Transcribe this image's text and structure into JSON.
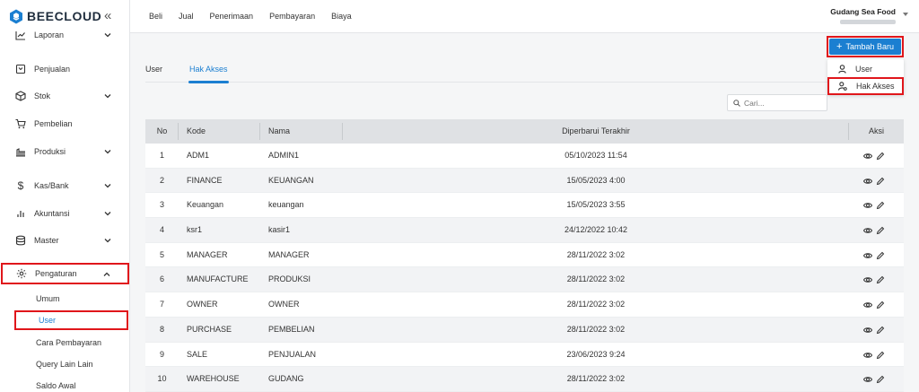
{
  "brand": {
    "name": "BEECLOUD",
    "color": "#1b7fd1"
  },
  "sidebar": {
    "items": [
      {
        "label": "Laporan",
        "icon": "trend-icon",
        "has_children": true
      },
      {
        "label": "Penjualan",
        "icon": "receipt-icon",
        "has_children": false
      },
      {
        "label": "Stok",
        "icon": "box-icon",
        "has_children": true
      },
      {
        "label": "Pembelian",
        "icon": "cart-icon",
        "has_children": false
      },
      {
        "label": "Produksi",
        "icon": "factory-icon",
        "has_children": true
      },
      {
        "label": "Kas/Bank",
        "icon": "dollar-icon",
        "has_children": true
      },
      {
        "label": "Akuntansi",
        "icon": "bar-chart-icon",
        "has_children": true
      },
      {
        "label": "Master",
        "icon": "database-icon",
        "has_children": true
      },
      {
        "label": "Pengaturan",
        "icon": "gear-icon",
        "has_children": true,
        "expanded": true
      }
    ],
    "subitems": [
      {
        "label": "Umum",
        "active": false
      },
      {
        "label": "User",
        "active": true
      },
      {
        "label": "Cara Pembayaran",
        "active": false
      },
      {
        "label": "Query Lain Lain",
        "active": false
      },
      {
        "label": "Saldo Awal",
        "active": false
      }
    ]
  },
  "topnav": [
    "Beli",
    "Jual",
    "Penerimaan",
    "Pembayaran",
    "Biaya"
  ],
  "company": {
    "name": "Gudang Sea Food"
  },
  "tabs": [
    {
      "label": "User",
      "active": false
    },
    {
      "label": "Hak Akses",
      "active": true
    }
  ],
  "add_button": {
    "label": "Tambah Baru"
  },
  "dropdown": [
    {
      "label": "User",
      "icon": "user-icon"
    },
    {
      "label": "Hak Akses",
      "icon": "user-key-icon"
    }
  ],
  "search": {
    "placeholder": "Cari..."
  },
  "table": {
    "columns": [
      "No",
      "Kode",
      "Nama",
      "Diperbarui Terakhir",
      "Aksi"
    ],
    "rows": [
      {
        "no": "1",
        "kode": "ADM1",
        "nama": "ADMIN1",
        "updated": "05/10/2023 11:54"
      },
      {
        "no": "2",
        "kode": "FINANCE",
        "nama": "KEUANGAN",
        "updated": "15/05/2023 4:00"
      },
      {
        "no": "3",
        "kode": "Keuangan",
        "nama": "keuangan",
        "updated": "15/05/2023 3:55"
      },
      {
        "no": "4",
        "kode": "ksr1",
        "nama": "kasir1",
        "updated": "24/12/2022 10:42"
      },
      {
        "no": "5",
        "kode": "MANAGER",
        "nama": "MANAGER",
        "updated": "28/11/2022 3:02"
      },
      {
        "no": "6",
        "kode": "MANUFACTURE",
        "nama": "PRODUKSI",
        "updated": "28/11/2022 3:02"
      },
      {
        "no": "7",
        "kode": "OWNER",
        "nama": "OWNER",
        "updated": "28/11/2022 3:02"
      },
      {
        "no": "8",
        "kode": "PURCHASE",
        "nama": "PEMBELIAN",
        "updated": "28/11/2022 3:02"
      },
      {
        "no": "9",
        "kode": "SALE",
        "nama": "PENJUALAN",
        "updated": "23/06/2023 9:24"
      },
      {
        "no": "10",
        "kode": "WAREHOUSE",
        "nama": "GUDANG",
        "updated": "28/11/2022 3:02"
      }
    ]
  }
}
